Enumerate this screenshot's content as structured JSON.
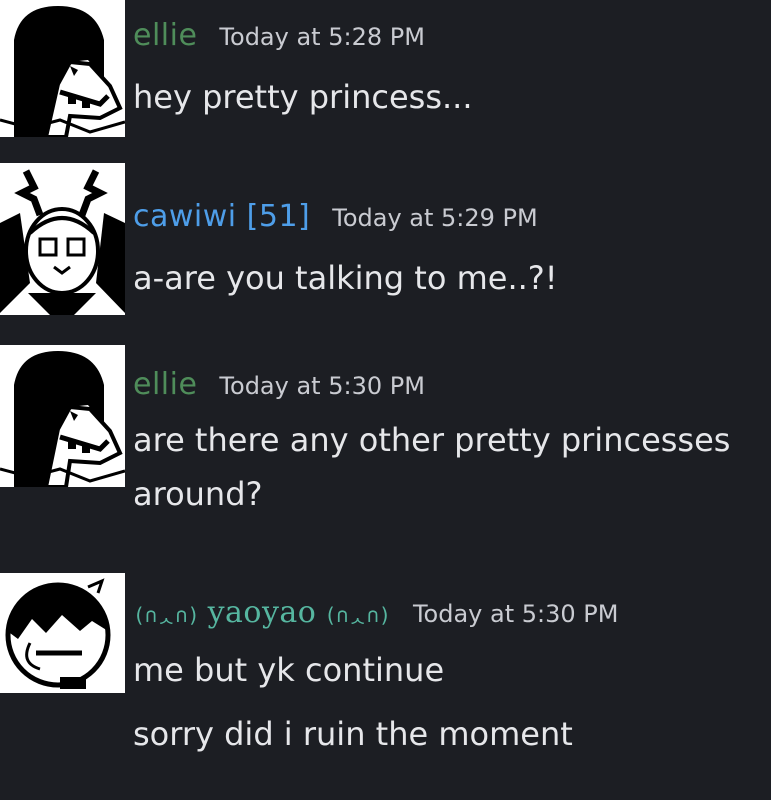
{
  "messages": [
    {
      "username": "ellie",
      "username_color": "#4f8d5a",
      "timestamp": "Today at 5:28 PM",
      "lines": [
        "hey pretty princess..."
      ],
      "avatar_icon": "dark-haired-character-avatar"
    },
    {
      "username": "cawiwi [51]",
      "username_color": "#4e9ee9",
      "timestamp": "Today at 5:29 PM",
      "lines": [
        "a-are you talking to me..?!"
      ],
      "avatar_icon": "antlered-goat-character-avatar"
    },
    {
      "username": "ellie",
      "username_color": "#4f8d5a",
      "timestamp": "Today at 5:30 PM",
      "lines": [
        "are there any other pretty princesses",
        "around?"
      ],
      "avatar_icon": "dark-haired-character-avatar"
    },
    {
      "username_prefix": "(∩ᆺ∩)",
      "username": "yaoyao",
      "username_suffix": "(∩ᆺ∩)",
      "username_color": "#56b6a0",
      "timestamp": "Today at 5:30 PM",
      "lines": [
        "me but yk continue",
        "sorry did i ruin the moment"
      ],
      "avatar_icon": "round-face-character-avatar"
    }
  ]
}
